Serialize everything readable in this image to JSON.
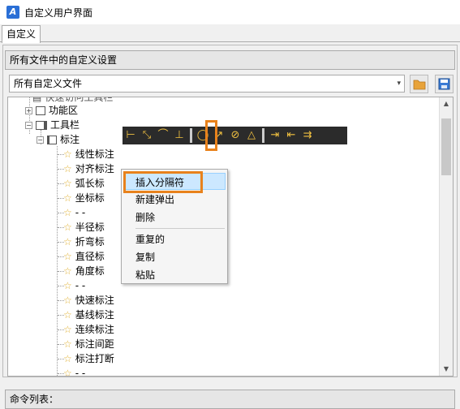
{
  "window": {
    "title": "自定义用户界面",
    "icon": "cad-app-icon"
  },
  "tabs": [
    {
      "label": "自定义"
    }
  ],
  "section": {
    "header": "所有文件中的自定义设置"
  },
  "file_select": {
    "value": "所有自定义文件",
    "caret": "⌄"
  },
  "buttons": {
    "open_icon": "folder-icon",
    "save_icon": "save-icon"
  },
  "tree": {
    "partial_top": "快速访问工具栏",
    "ribbon": {
      "expander": "+",
      "label": "功能区"
    },
    "toolbars": {
      "expander": "−",
      "label": "工具栏"
    },
    "dim": {
      "expander": "−",
      "label": "标注"
    },
    "items": [
      "线性标注",
      "对齐标注",
      "弧长标注",
      "坐标标注",
      "- -",
      "半径标注",
      "折弯标注",
      "直径标注",
      "角度标注",
      "- -",
      "快速标注",
      "基线标注",
      "连续标注",
      "标注间距",
      "标注打断",
      "- -"
    ],
    "visible_items": [
      "线性标注",
      "对齐标注",
      "弧长标",
      "坐标标",
      "- -",
      "半径标",
      "折弯标",
      "直径标",
      "角度标",
      "- -",
      "快速标注",
      "基线标注",
      "连续标注",
      "标注间距",
      "标注打断",
      "- -"
    ]
  },
  "context_menu": {
    "items": [
      "插入分隔符",
      "新建弹出",
      "删除",
      "重复的",
      "复制",
      "粘贴"
    ],
    "hover_index": 0
  },
  "bottom": {
    "header": "命令列表："
  },
  "colors": {
    "highlight": "#e8821c",
    "hover": "#cce8ff",
    "star": "#e0b030"
  }
}
